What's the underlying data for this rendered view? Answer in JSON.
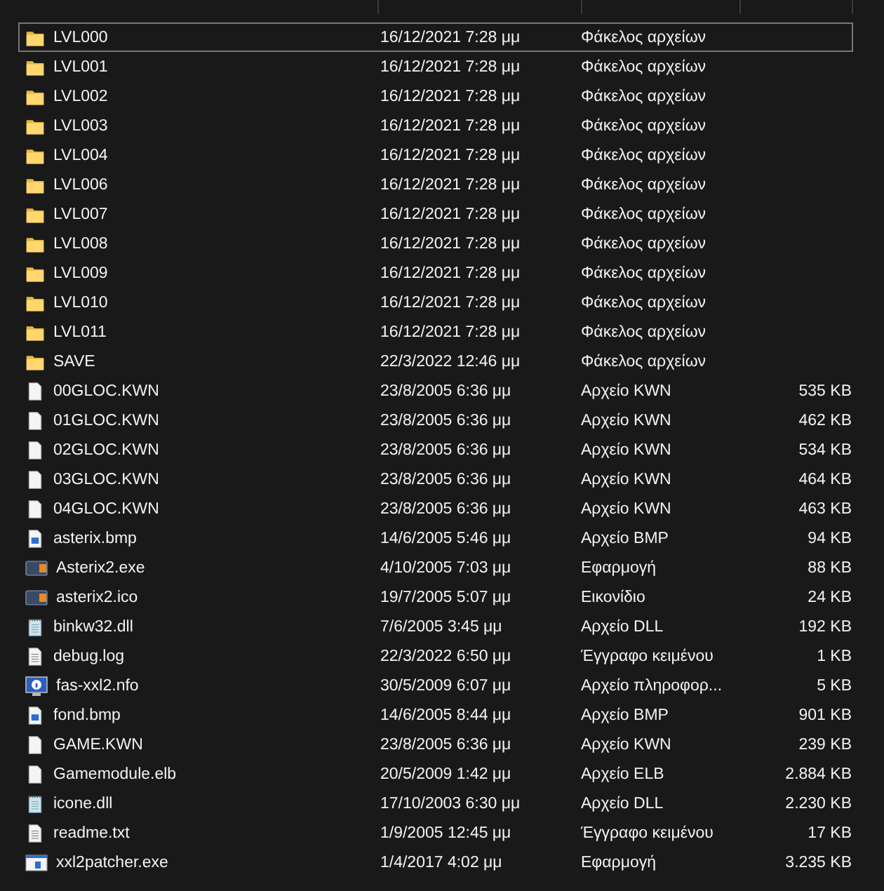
{
  "files": [
    {
      "name": "LVL000",
      "modified": "16/12/2021 7:28 μμ",
      "type": "Φάκελος αρχείων",
      "kind": "folder",
      "selected": true
    },
    {
      "name": "LVL001",
      "modified": "16/12/2021 7:28 μμ",
      "type": "Φάκελος αρχείων",
      "kind": "folder",
      "selected": false
    },
    {
      "name": "LVL002",
      "modified": "16/12/2021 7:28 μμ",
      "type": "Φάκελος αρχείων",
      "kind": "folder",
      "selected": false
    },
    {
      "name": "LVL003",
      "modified": "16/12/2021 7:28 μμ",
      "type": "Φάκελος αρχείων",
      "kind": "folder",
      "selected": false
    },
    {
      "name": "LVL004",
      "modified": "16/12/2021 7:28 μμ",
      "type": "Φάκελος αρχείων",
      "kind": "folder",
      "selected": false
    },
    {
      "name": "LVL006",
      "modified": "16/12/2021 7:28 μμ",
      "type": "Φάκελος αρχείων",
      "kind": "folder",
      "selected": false
    },
    {
      "name": "LVL007",
      "modified": "16/12/2021 7:28 μμ",
      "type": "Φάκελος αρχείων",
      "kind": "folder",
      "selected": false
    },
    {
      "name": "LVL008",
      "modified": "16/12/2021 7:28 μμ",
      "type": "Φάκελος αρχείων",
      "kind": "folder",
      "selected": false
    },
    {
      "name": "LVL009",
      "modified": "16/12/2021 7:28 μμ",
      "type": "Φάκελος αρχείων",
      "kind": "folder",
      "selected": false
    },
    {
      "name": "LVL010",
      "modified": "16/12/2021 7:28 μμ",
      "type": "Φάκελος αρχείων",
      "kind": "folder",
      "selected": false
    },
    {
      "name": "LVL011",
      "modified": "16/12/2021 7:28 μμ",
      "type": "Φάκελος αρχείων",
      "kind": "folder",
      "selected": false
    },
    {
      "name": "SAVE",
      "modified": "22/3/2022 12:46 μμ",
      "type": "Φάκελος αρχείων",
      "kind": "folder",
      "selected": false
    },
    {
      "name": "00GLOC.KWN",
      "modified": "23/8/2005 6:36 μμ",
      "type": "Αρχείο KWN",
      "size": "535 KB",
      "kind": "file",
      "selected": false
    },
    {
      "name": "01GLOC.KWN",
      "modified": "23/8/2005 6:36 μμ",
      "type": "Αρχείο KWN",
      "size": "462 KB",
      "kind": "file",
      "selected": false
    },
    {
      "name": "02GLOC.KWN",
      "modified": "23/8/2005 6:36 μμ",
      "type": "Αρχείο KWN",
      "size": "534 KB",
      "kind": "file",
      "selected": false
    },
    {
      "name": "03GLOC.KWN",
      "modified": "23/8/2005 6:36 μμ",
      "type": "Αρχείο KWN",
      "size": "464 KB",
      "kind": "file",
      "selected": false
    },
    {
      "name": "04GLOC.KWN",
      "modified": "23/8/2005 6:36 μμ",
      "type": "Αρχείο KWN",
      "size": "463 KB",
      "kind": "file",
      "selected": false
    },
    {
      "name": "asterix.bmp",
      "modified": "14/6/2005 5:46 μμ",
      "type": "Αρχείο BMP",
      "size": "94 KB",
      "kind": "image",
      "selected": false
    },
    {
      "name": "Asterix2.exe",
      "modified": "4/10/2005 7:03 μμ",
      "type": "Εφαρμογή",
      "size": "88 KB",
      "kind": "game",
      "selected": false
    },
    {
      "name": "asterix2.ico",
      "modified": "19/7/2005 5:07 μμ",
      "type": "Εικονίδιο",
      "size": "24 KB",
      "kind": "game",
      "selected": false
    },
    {
      "name": "binkw32.dll",
      "modified": "7/6/2005 3:45 μμ",
      "type": "Αρχείο DLL",
      "size": "192 KB",
      "kind": "library",
      "selected": false
    },
    {
      "name": "debug.log",
      "modified": "22/3/2022 6:50 μμ",
      "type": "Έγγραφο κειμένου",
      "size": "1 KB",
      "kind": "text",
      "selected": false
    },
    {
      "name": "fas-xxl2.nfo",
      "modified": "30/5/2009 6:07 μμ",
      "type": "Αρχείο πληροφορ...",
      "size": "5 KB",
      "kind": "info",
      "selected": false
    },
    {
      "name": "fond.bmp",
      "modified": "14/6/2005 8:44 μμ",
      "type": "Αρχείο BMP",
      "size": "901 KB",
      "kind": "image",
      "selected": false
    },
    {
      "name": "GAME.KWN",
      "modified": "23/8/2005 6:36 μμ",
      "type": "Αρχείο KWN",
      "size": "239 KB",
      "kind": "file",
      "selected": false
    },
    {
      "name": "Gamemodule.elb",
      "modified": "20/5/2009 1:42 μμ",
      "type": "Αρχείο ELB",
      "size": "2.884 KB",
      "kind": "file",
      "selected": false
    },
    {
      "name": "icone.dll",
      "modified": "17/10/2003 6:30 μμ",
      "type": "Αρχείο DLL",
      "size": "2.230 KB",
      "kind": "library",
      "selected": false
    },
    {
      "name": "readme.txt",
      "modified": "1/9/2005 12:45 μμ",
      "type": "Έγγραφο κειμένου",
      "size": "17 KB",
      "kind": "text",
      "selected": false
    },
    {
      "name": "xxl2patcher.exe",
      "modified": "1/4/2017 4:02 μμ",
      "type": "Εφαρμογή",
      "size": "3.235 KB",
      "kind": "app",
      "selected": false
    }
  ]
}
